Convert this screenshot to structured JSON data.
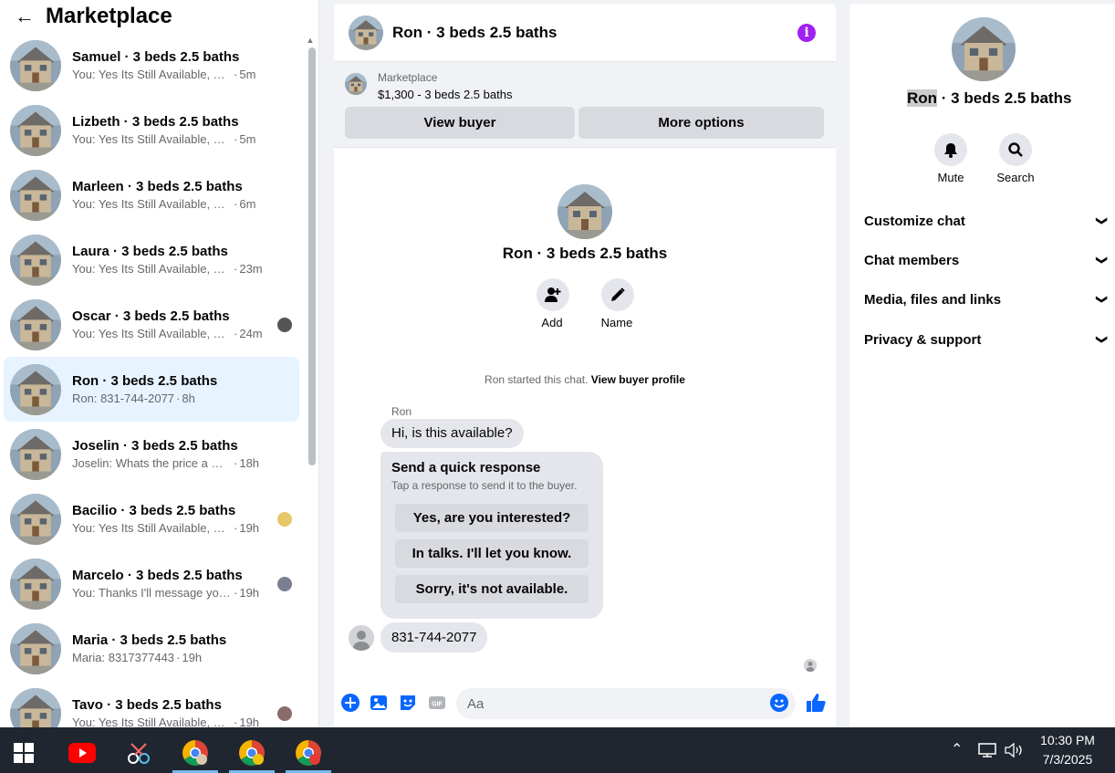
{
  "header": {
    "title": "Marketplace"
  },
  "conversations": [
    {
      "name": "Samuel · 3 beds 2.5 baths",
      "preview": "You: Yes Its Still Available, Please S...",
      "time": "5m"
    },
    {
      "name": "Lizbeth · 3 beds 2.5 baths",
      "preview": "You: Yes Its Still Available, Please S...",
      "time": "5m"
    },
    {
      "name": "Marleen · 3 beds 2.5 baths",
      "preview": "You: Yes Its Still Available, Please S...",
      "time": "6m"
    },
    {
      "name": "Laura · 3 beds 2.5 baths",
      "preview": "You: Yes Its Still Available, Please ...",
      "time": "23m"
    },
    {
      "name": "Oscar · 3 beds 2.5 baths",
      "preview": "You: Yes Its Still Available, Plea...",
      "time": "24m"
    },
    {
      "name": "Ron · 3 beds 2.5 baths",
      "preview": "Ron: 831-744-2077",
      "time": "8h"
    },
    {
      "name": "Joselin · 3 beds 2.5 baths",
      "preview": "Joselin: Whats the price a month",
      "time": "18h"
    },
    {
      "name": "Bacilio · 3 beds 2.5 baths",
      "preview": "You: Yes Its Still Available, Pleas...",
      "time": "19h"
    },
    {
      "name": "Marcelo · 3 beds 2.5 baths",
      "preview": "You: Thanks I'll message you in...",
      "time": "19h"
    },
    {
      "name": "Maria · 3 beds 2.5 baths",
      "preview": "Maria: 8317377443",
      "time": "19h"
    },
    {
      "name": "Tavo · 3 beds 2.5 baths",
      "preview": "You: Yes Its Still Available, Pleas...",
      "time": "19h"
    }
  ],
  "chat": {
    "title": "Ron · 3 beds 2.5 baths",
    "listing_source": "Marketplace",
    "listing_price": "$1,300 - 3 beds 2.5 baths",
    "view_buyer": "View buyer",
    "more_options": "More options",
    "profile_name": "Ron · 3 beds 2.5 baths",
    "add_label": "Add",
    "name_label": "Name",
    "started_text": "Ron started this chat.",
    "view_buyer_profile": "View buyer profile",
    "sender": "Ron",
    "message1": "Hi, is this available?",
    "quick_title": "Send a quick response",
    "quick_sub": "Tap a response to send it to the buyer.",
    "quick_responses": [
      "Yes, are you interested?",
      "In talks. I'll let you know.",
      "Sorry, it's not available."
    ],
    "message2": "831-744-2077",
    "input_placeholder": "Aa"
  },
  "details": {
    "name_highlight": "Ron",
    "name_rest": " · 3 beds 2.5 baths",
    "mute": "Mute",
    "search": "Search",
    "sections": [
      "Customize chat",
      "Chat members",
      "Media, files and links",
      "Privacy & support"
    ]
  },
  "taskbar": {
    "time": "10:30 PM",
    "date": "7/3/2025"
  },
  "colors": {
    "accent": "#0866ff",
    "info": "#a020f0",
    "active_row": "#e7f3ff",
    "taskbar": "#20262f"
  }
}
